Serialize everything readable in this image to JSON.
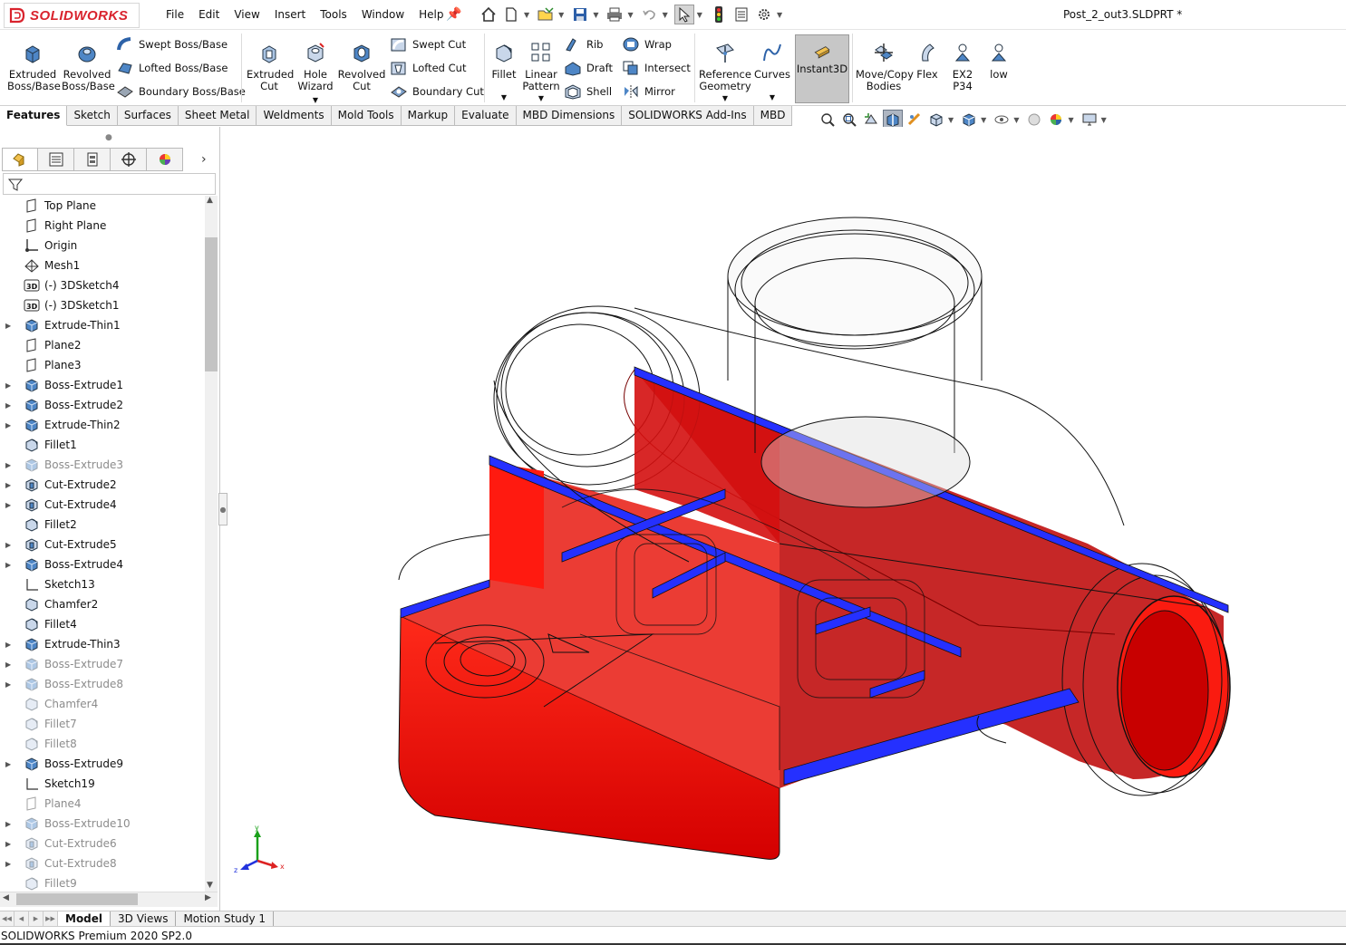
{
  "app": {
    "brand": "SOLIDWORKS",
    "document_title": "Post_2_out3.SLDPRT *",
    "status": "SOLIDWORKS Premium 2020 SP2.0"
  },
  "menu": [
    "File",
    "Edit",
    "View",
    "Insert",
    "Tools",
    "Window",
    "Help"
  ],
  "commands": {
    "extruded_boss": "Extruded\nBoss/Base",
    "revolved_boss": "Revolved\nBoss/Base",
    "swept_boss": "Swept Boss/Base",
    "lofted_boss": "Lofted Boss/Base",
    "boundary_boss": "Boundary Boss/Base",
    "extruded_cut": "Extruded\nCut",
    "hole_wizard": "Hole\nWizard",
    "revolved_cut": "Revolved\nCut",
    "swept_cut": "Swept Cut",
    "lofted_cut": "Lofted Cut",
    "boundary_cut": "Boundary Cut",
    "fillet": "Fillet",
    "linear_pattern": "Linear\nPattern",
    "rib": "Rib",
    "draft": "Draft",
    "shell": "Shell",
    "wrap": "Wrap",
    "intersect": "Intersect",
    "mirror": "Mirror",
    "reference_geometry": "Reference\nGeometry",
    "curves": "Curves",
    "instant3d": "Instant3D",
    "move_copy": "Move/Copy\nBodies",
    "flex": "Flex",
    "ex2": "EX2 P34",
    "iow": "low"
  },
  "tabs": [
    "Features",
    "Sketch",
    "Surfaces",
    "Sheet Metal",
    "Weldments",
    "Mold Tools",
    "Markup",
    "Evaluate",
    "MBD Dimensions",
    "SOLIDWORKS Add-Ins",
    "MBD"
  ],
  "active_tab": "Features",
  "tree": [
    {
      "label": "Top Plane",
      "icon": "plane",
      "exp": false,
      "dim": false
    },
    {
      "label": "Right Plane",
      "icon": "plane",
      "exp": false,
      "dim": false
    },
    {
      "label": "Origin",
      "icon": "origin",
      "exp": false,
      "dim": false
    },
    {
      "label": "Mesh1",
      "icon": "mesh",
      "exp": false,
      "dim": false
    },
    {
      "label": "(-) 3DSketch4",
      "icon": "sketch3d",
      "exp": false,
      "dim": false
    },
    {
      "label": "(-) 3DSketch1",
      "icon": "sketch3d",
      "exp": false,
      "dim": false
    },
    {
      "label": "Extrude-Thin1",
      "icon": "boss",
      "exp": true,
      "dim": false
    },
    {
      "label": "Plane2",
      "icon": "plane",
      "exp": false,
      "dim": false
    },
    {
      "label": "Plane3",
      "icon": "plane",
      "exp": false,
      "dim": false
    },
    {
      "label": "Boss-Extrude1",
      "icon": "boss",
      "exp": true,
      "dim": false
    },
    {
      "label": "Boss-Extrude2",
      "icon": "boss",
      "exp": true,
      "dim": false
    },
    {
      "label": "Extrude-Thin2",
      "icon": "boss",
      "exp": true,
      "dim": false
    },
    {
      "label": "Fillet1",
      "icon": "fillet",
      "exp": false,
      "dim": false
    },
    {
      "label": "Boss-Extrude3",
      "icon": "boss",
      "exp": true,
      "dim": true
    },
    {
      "label": "Cut-Extrude2",
      "icon": "cut",
      "exp": true,
      "dim": false
    },
    {
      "label": "Cut-Extrude4",
      "icon": "cut",
      "exp": true,
      "dim": false
    },
    {
      "label": "Fillet2",
      "icon": "fillet",
      "exp": false,
      "dim": false
    },
    {
      "label": "Cut-Extrude5",
      "icon": "cut",
      "exp": true,
      "dim": false
    },
    {
      "label": "Boss-Extrude4",
      "icon": "boss",
      "exp": true,
      "dim": false
    },
    {
      "label": "Sketch13",
      "icon": "sketch",
      "exp": false,
      "dim": false
    },
    {
      "label": "Chamfer2",
      "icon": "chamfer",
      "exp": false,
      "dim": false
    },
    {
      "label": "Fillet4",
      "icon": "fillet",
      "exp": false,
      "dim": false
    },
    {
      "label": "Extrude-Thin3",
      "icon": "boss",
      "exp": true,
      "dim": false
    },
    {
      "label": "Boss-Extrude7",
      "icon": "boss",
      "exp": true,
      "dim": true
    },
    {
      "label": "Boss-Extrude8",
      "icon": "boss",
      "exp": true,
      "dim": true
    },
    {
      "label": "Chamfer4",
      "icon": "chamfer",
      "exp": false,
      "dim": true
    },
    {
      "label": "Fillet7",
      "icon": "fillet",
      "exp": false,
      "dim": true
    },
    {
      "label": "Fillet8",
      "icon": "fillet",
      "exp": false,
      "dim": true
    },
    {
      "label": "Boss-Extrude9",
      "icon": "boss",
      "exp": true,
      "dim": false
    },
    {
      "label": "Sketch19",
      "icon": "sketch",
      "exp": false,
      "dim": false
    },
    {
      "label": "Plane4",
      "icon": "plane",
      "exp": false,
      "dim": true
    },
    {
      "label": "Boss-Extrude10",
      "icon": "boss",
      "exp": true,
      "dim": true
    },
    {
      "label": "Cut-Extrude6",
      "icon": "cut",
      "exp": true,
      "dim": true
    },
    {
      "label": "Cut-Extrude8",
      "icon": "cut",
      "exp": true,
      "dim": true
    },
    {
      "label": "Fillet9",
      "icon": "fillet",
      "exp": false,
      "dim": true
    }
  ],
  "bottom_tabs": [
    "Model",
    "3D Views",
    "Motion Study 1"
  ],
  "active_bottom_tab": "Model",
  "triad": {
    "x": "x",
    "y": "y",
    "z": "z"
  },
  "colors": {
    "brand": "#d9232d",
    "section_red": "#ff1a1a",
    "section_blue": "#2530ff",
    "accent_blue": "#1f6fd0"
  }
}
